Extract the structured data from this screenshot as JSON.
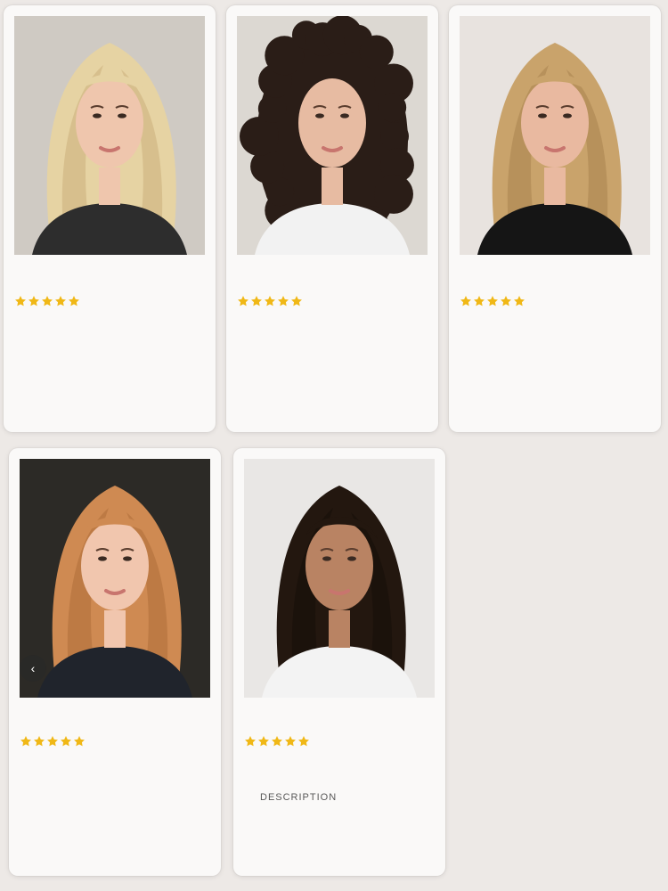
{
  "colors": {
    "page_bg": "#ede9e6",
    "card_bg": "#faf9f8",
    "star": "#f0b816"
  },
  "icons": {
    "star": "star-icon",
    "carousel_prev": "chevron-left-icon"
  },
  "cards": [
    {
      "image": "blonde-long-layered-hair-photo",
      "rating": 5,
      "hair": "#e6d3a3",
      "hair_dark": "#b99a63",
      "bg": "#cfcac3",
      "skin": "#efc6ad",
      "shirt": "#2d2d2d"
    },
    {
      "image": "dark-curly-hair-photo",
      "rating": 5,
      "hair": "#2a1d17",
      "hair_dark": "#120c09",
      "bg": "#dcd8d2",
      "skin": "#e7bba2",
      "shirt": "#f2f2f2"
    },
    {
      "image": "honey-blonde-blowout-hair-photo",
      "rating": 5,
      "hair": "#c9a36b",
      "hair_dark": "#94703e",
      "bg": "#e8e3df",
      "skin": "#e9b9a0",
      "shirt": "#151515"
    },
    {
      "image": "copper-red-wavy-hair-photo",
      "rating": 5,
      "hair": "#cf8a52",
      "hair_dark": "#9b5b2c",
      "bg": "#2c2a26",
      "skin": "#f1c6ae",
      "shirt": "#20242c",
      "has_carousel": true,
      "carousel_symbol": "‹"
    },
    {
      "image": "dark-brown-voluminous-hair-photo",
      "rating": 5,
      "hair": "#23170f",
      "hair_dark": "#0f0905",
      "bg": "#e9e7e5",
      "skin": "#b98363",
      "shirt": "#f3f3f3",
      "footer_text": "DESCRIPTION"
    }
  ]
}
